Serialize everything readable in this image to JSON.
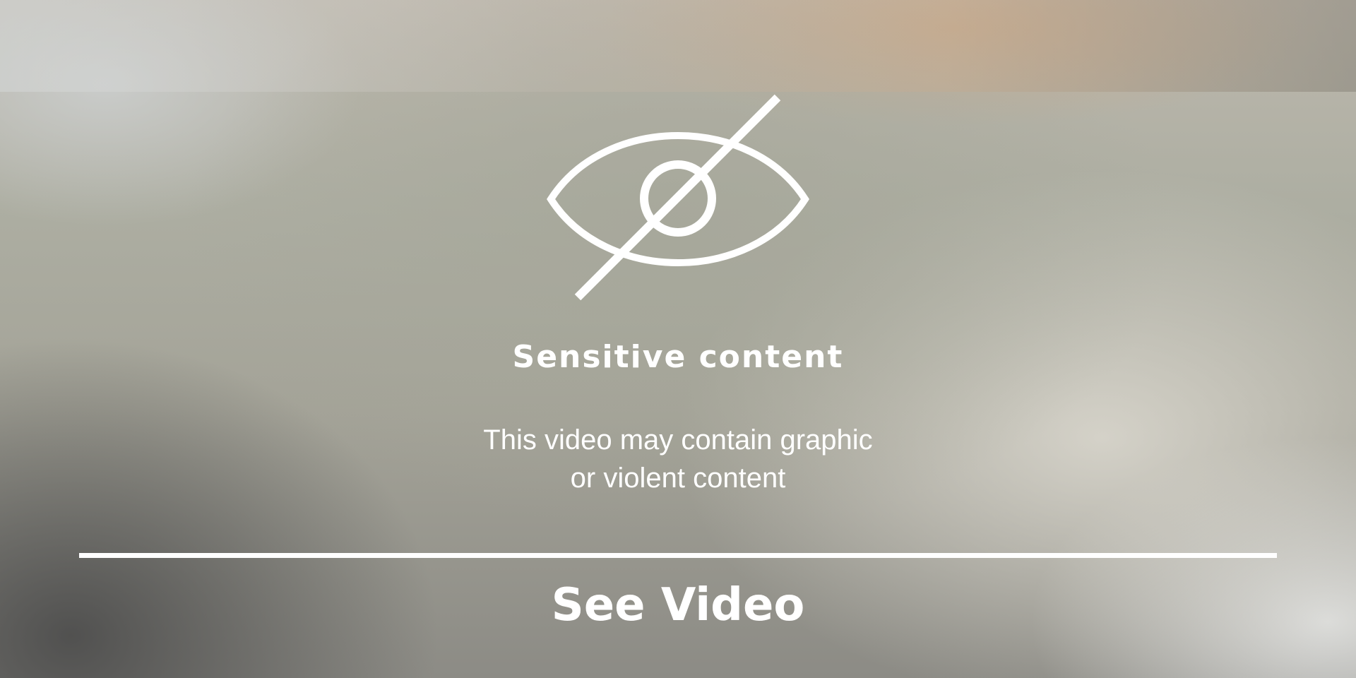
{
  "overlay": {
    "icon": "eye-slash-icon",
    "title": "Sensitive content",
    "description_lines": [
      "This video may contain graphic",
      "or violent content"
    ],
    "action_label": "See Video"
  }
}
